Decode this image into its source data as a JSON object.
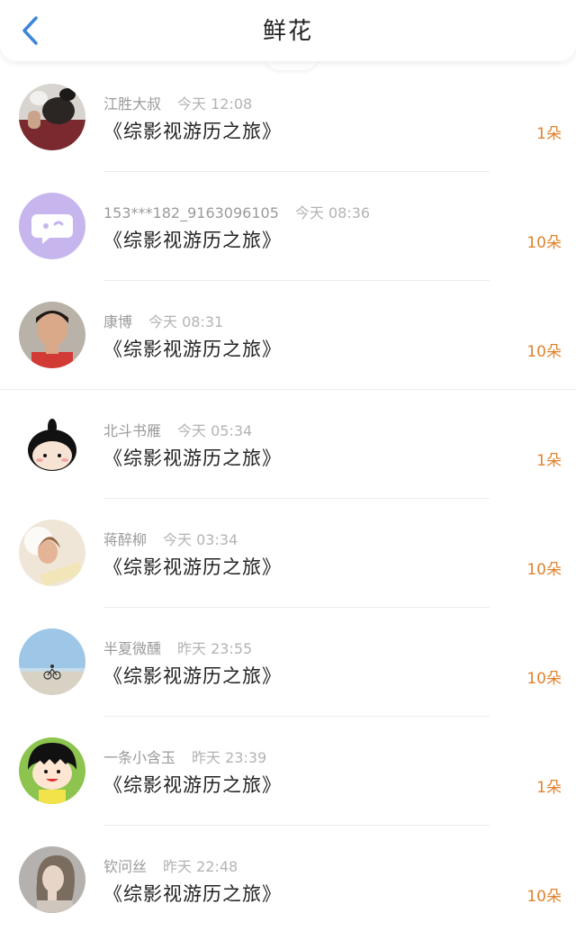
{
  "header": {
    "title": "鲜花",
    "back_icon": "chevron-left-icon",
    "accent": "#3b86d8"
  },
  "items": [
    {
      "user": "江胜大叔",
      "time": "今天 12:08",
      "book": "《综影视游历之旅》",
      "amount": "1朵",
      "avatar": "photo-cat"
    },
    {
      "user": "153***182_9163096105",
      "time": "今天 08:36",
      "book": "《综影视游历之旅》",
      "amount": "10朵",
      "avatar": "default-chat"
    },
    {
      "user": "康博",
      "time": "今天 08:31",
      "book": "《综影视游历之旅》",
      "amount": "10朵",
      "avatar": "photo-man"
    },
    {
      "user": "北斗书雁",
      "time": "今天 05:34",
      "book": "《综影视游历之旅》",
      "amount": "1朵",
      "avatar": "cartoon-girl"
    },
    {
      "user": "蒋醉柳",
      "time": "今天 03:34",
      "book": "《综影视游历之旅》",
      "amount": "10朵",
      "avatar": "photo-girl"
    },
    {
      "user": "半夏微醺",
      "time": "昨天 23:55",
      "book": "《综影视游历之旅》",
      "amount": "10朵",
      "avatar": "photo-beach"
    },
    {
      "user": "一条小含玉",
      "time": "昨天 23:39",
      "book": "《综影视游历之旅》",
      "amount": "1朵",
      "avatar": "cartoon-maruko"
    },
    {
      "user": "钦问丝",
      "time": "昨天 22:48",
      "book": "《综影视游历之旅》",
      "amount": "10朵",
      "avatar": "photo-woman"
    }
  ]
}
